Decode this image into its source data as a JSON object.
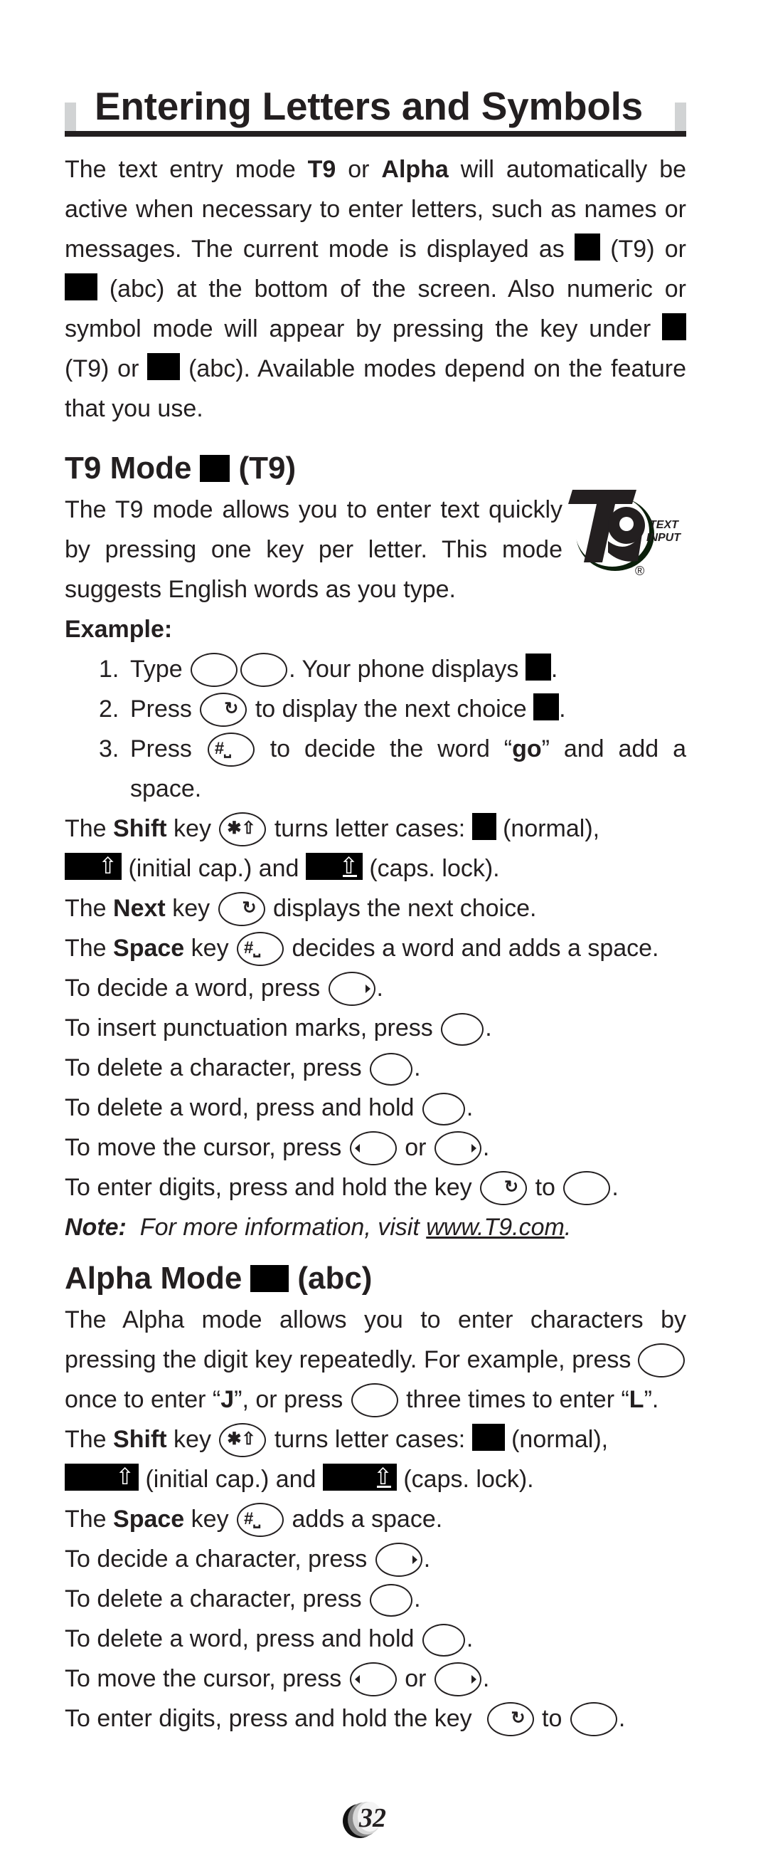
{
  "page": {
    "title": "Entering Letters and Symbols",
    "page_number": "32"
  },
  "intro": {
    "p1_a": "The text entry mode ",
    "p1_t9": "T9",
    "p1_b": " or ",
    "p1_alpha": "Alpha",
    "p1_c": " will automatically be active when necessary to enter letters, such as names or messages. The current mode is displayed as ",
    "p1_d": " (T9) or ",
    "p1_e": " (abc) at the bottom of the screen. Also numeric or symbol mode will appear by pressing the key under ",
    "p1_f": " (T9) or ",
    "p1_g": " (abc). Available modes depend on the feature that you use."
  },
  "t9": {
    "heading_a": "T9 Mode",
    "heading_b": "(T9)",
    "desc": "The T9 mode allows you to enter text quickly by pressing one key per letter. This mode suggests English words as you type.",
    "logo_text_1": "TEXT",
    "logo_text_2": "INPUT",
    "logo_reg": "®",
    "example_label": "Example:",
    "steps": [
      {
        "num": "1.",
        "a": "Type",
        "b": ". Your phone displays",
        "c": "."
      },
      {
        "num": "2.",
        "a": "Press",
        "b": "to display the next choice",
        "c": "."
      },
      {
        "num": "3.",
        "a": "Press",
        "b": "to decide the word “",
        "bold": "go",
        "c": "” and add a",
        "cont": "space."
      }
    ],
    "shift_a": "The ",
    "shift_b": "Shift",
    "shift_c": " key ",
    "shift_d": " turns letter cases: ",
    "shift_e": " (normal),",
    "shift_f": " (initial cap.) and ",
    "shift_g": " (caps. lock).",
    "next_a": "The ",
    "next_b": "Next",
    "next_c": " key ",
    "next_d": " displays the next choice.",
    "space_a": "The ",
    "space_b": "Space",
    "space_c": " key ",
    "space_d": " decides a word and adds a space.",
    "decide": "To decide a word, press",
    "punct": "To insert punctuation marks, press",
    "del_char": "To delete a character, press",
    "del_word": "To delete a word, press and hold",
    "move_a": "To move the cursor, press",
    "move_b": "or",
    "digits_a": "To enter digits, press and hold the key",
    "digits_b": "to",
    "note_label": "Note:",
    "note_text": "For more information, visit",
    "note_link": "www.T9.com",
    "period": "."
  },
  "alpha": {
    "heading_a": "Alpha Mode",
    "heading_b": "(abc)",
    "desc_a": "The Alpha mode allows you to enter characters by pressing the digit key repeatedly. For example, press ",
    "desc_b": " once to enter “",
    "desc_j": "J",
    "desc_c": "”, or press ",
    "desc_d": " three times to enter “",
    "desc_l": "L",
    "desc_e": "”.",
    "shift_a": "The ",
    "shift_b": "Shift",
    "shift_c": " key ",
    "shift_d": " turns letter cases: ",
    "shift_e": " (normal),",
    "shift_f": " (initial cap.) and ",
    "shift_g": " (caps. lock).",
    "space_a": "The ",
    "space_b": "Space",
    "space_c": " key ",
    "space_d": " adds a space.",
    "decide": "To decide a character, press",
    "del_char": "To delete a character, press",
    "del_word": "To delete a word, press and hold",
    "move_a": "To move the cursor, press",
    "move_b": "or",
    "digits_a": "To enter digits, press and hold the key",
    "digits_b": "to",
    "period": "."
  },
  "glyphs": {
    "next_key": "↻",
    "space_key": "#⎵",
    "shift_key": "✱⇧",
    "shift_arrow": "⇧"
  }
}
